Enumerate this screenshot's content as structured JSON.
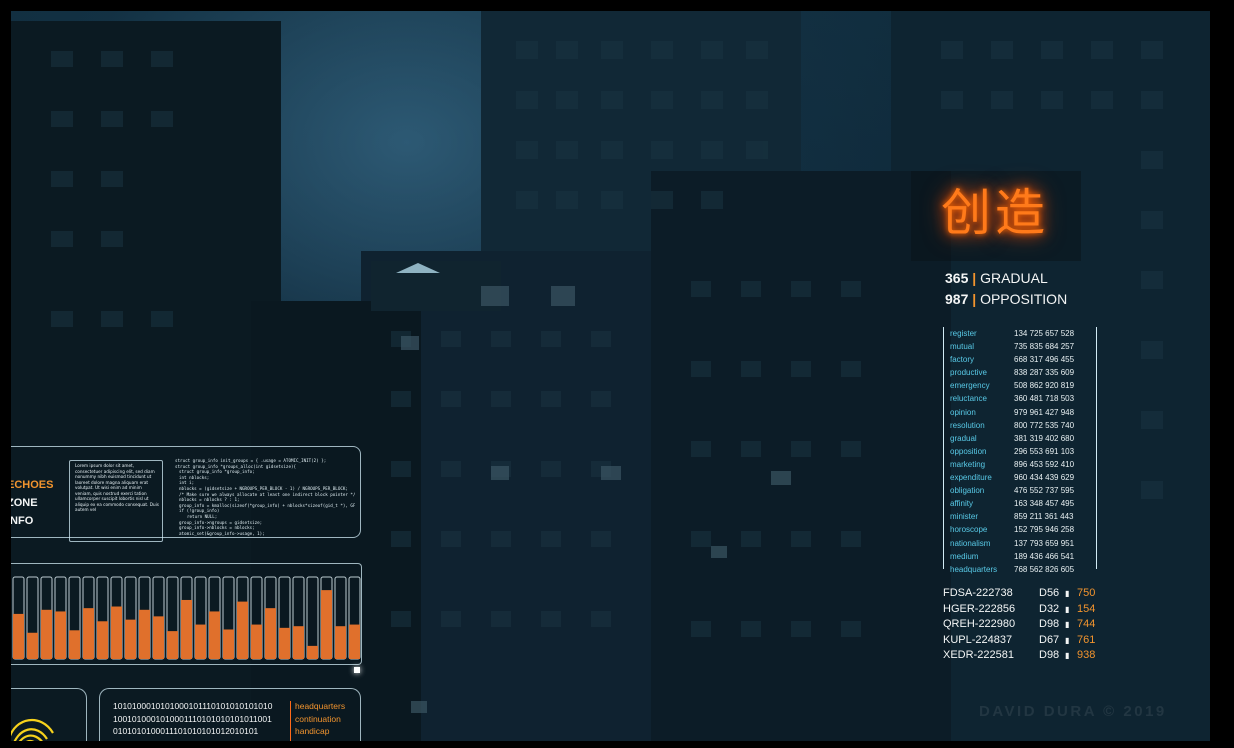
{
  "sign": {
    "chinese": "创造",
    "stats": [
      {
        "number": "365",
        "label": "GRADUAL"
      },
      {
        "number": "987",
        "label": "OPPOSITION"
      }
    ]
  },
  "word_table": {
    "rows": [
      {
        "word": "register",
        "nums": "134 725 657 528"
      },
      {
        "word": "mutual",
        "nums": "735 835 684 257"
      },
      {
        "word": "factory",
        "nums": "668 317 496 455"
      },
      {
        "word": "productive",
        "nums": "838 287 335 609"
      },
      {
        "word": "emergency",
        "nums": "508 862 920 819"
      },
      {
        "word": "reluctance",
        "nums": "360 481 718 503"
      },
      {
        "word": "opinion",
        "nums": "979 961 427 948"
      },
      {
        "word": "resolution",
        "nums": "800 772 535 740"
      },
      {
        "word": "gradual",
        "nums": "381 319 402 680"
      },
      {
        "word": "opposition",
        "nums": "296 553 691 103"
      },
      {
        "word": "marketing",
        "nums": "896 453 592 410"
      },
      {
        "word": "expenditure",
        "nums": "960 434 439 629"
      },
      {
        "word": "obligation",
        "nums": "476 552 737 595"
      },
      {
        "word": "affinity",
        "nums": "163 348 457 495"
      },
      {
        "word": "minister",
        "nums": "859 211 361 443"
      },
      {
        "word": "horoscope",
        "nums": "152 795 946 258"
      },
      {
        "word": "nationalism",
        "nums": "137 793 659 951"
      },
      {
        "word": "medium",
        "nums": "189 436 466 541"
      },
      {
        "word": "headquarters",
        "nums": "768 562 826 605"
      }
    ]
  },
  "codes": [
    {
      "id": "FDSA-222738",
      "code": "D56",
      "value": "750"
    },
    {
      "id": "HGER-222856",
      "code": "D32",
      "value": "154"
    },
    {
      "id": "QREH-222980",
      "code": "D98",
      "value": "744"
    },
    {
      "id": "KUPL-224837",
      "code": "D67",
      "value": "761"
    },
    {
      "id": "XEDR-222581",
      "code": "D98",
      "value": "938"
    }
  ],
  "left_hud": {
    "menu": [
      "ECHOES",
      "ZONE",
      "INFO"
    ],
    "lorem": "Lorem ipsum dolor sit amet, consectetuer adipiscing elit, sed diam nonummy nibh euismod tincidunt ut laoreet dolore magna aliquam erat volutpat. Ut wisi enim ad minim veniam, quis nostrud exerci tation ullamcorper suscipit lobortis nisl ut aliquip ex ea commodo consequat. Duis autem vel",
    "code_lines": [
      "struct group_info init_groups = { .usage = ATOMIC_INIT(2) };",
      "struct group_info *groups_alloc(int gidsetsize){",
      "struct group_info *group_info;",
      "int nblocks;",
      "int i;",
      "nblocks = (gidsetsize + NGROUPS_PER_BLOCK - 1) / NGROUPS_PER_BLOCK;",
      "/* Make sure we always allocate at least one indirect block pointer */",
      "nblocks = nblocks ? : 1;",
      "group_info = kmalloc(sizeof(*group_info) + nblocks*sizeof(gid_t *), GFP_USER);",
      "if (!group_info)",
      "return NULL;",
      "group_info->ngroups = gidsetsize;",
      "group_info->nblocks = nblocks;",
      "atomic_set(&group_info->usage, 1);"
    ],
    "binary_lines": [
      "1010100010101000101110101010101010",
      "1001010001010001110101010101011001",
      "0101010100011101010101012010101"
    ],
    "words": [
      "headquarters",
      "continuation",
      "handicap"
    ],
    "bar_values": [
      0.55,
      0.32,
      0.6,
      0.58,
      0.35,
      0.62,
      0.46,
      0.64,
      0.48,
      0.6,
      0.52,
      0.34,
      0.72,
      0.42,
      0.58,
      0.36,
      0.7,
      0.42,
      0.62,
      0.38,
      0.4,
      0.16,
      0.84,
      0.4,
      0.42
    ]
  },
  "watermark": "DAVID DURA © 2019",
  "colors": {
    "accent_orange": "#f2942e",
    "neon": "#ff7a1a",
    "hud_line": "#d2ebf5",
    "table_text": "#58c9e6"
  }
}
